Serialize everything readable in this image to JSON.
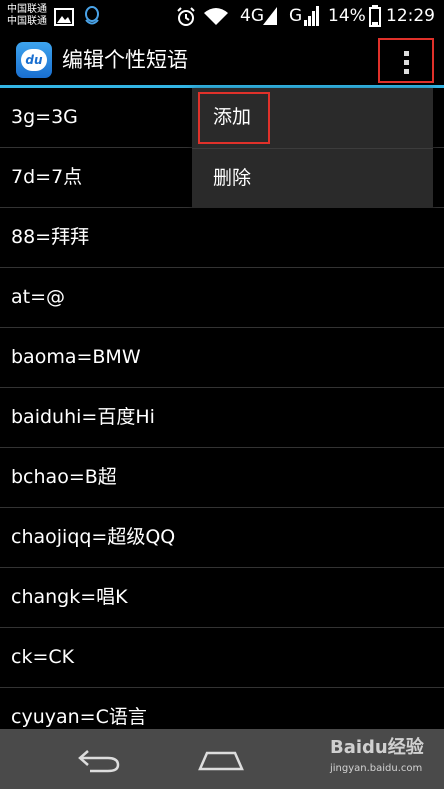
{
  "status_bar": {
    "carrier_1": "中国联通",
    "carrier_2": "中国联通",
    "network_1": "4G",
    "network_2": "G",
    "battery": "14%",
    "time": "12:29"
  },
  "action_bar": {
    "app_icon_text": "du",
    "title": "编辑个性短语"
  },
  "phrases": [
    "3g=3G",
    "7d=7点",
    "88=拜拜",
    "at=@",
    "baoma=BMW",
    "baiduhi=百度Hi",
    "bchao=B超",
    "chaojiqq=超级QQ",
    "changk=唱K",
    "ck=CK",
    "cyuyan=C语言"
  ],
  "menu": {
    "add_label": "添加",
    "delete_label": "删除"
  },
  "watermark": {
    "brand": "Baidu经验",
    "url": "jingyan.baidu.com"
  },
  "colors": {
    "accent": "#33b5e5",
    "highlight": "#e0312a",
    "menu_bg": "#2a2a2a",
    "navbar_bg": "#4a4a4a"
  }
}
